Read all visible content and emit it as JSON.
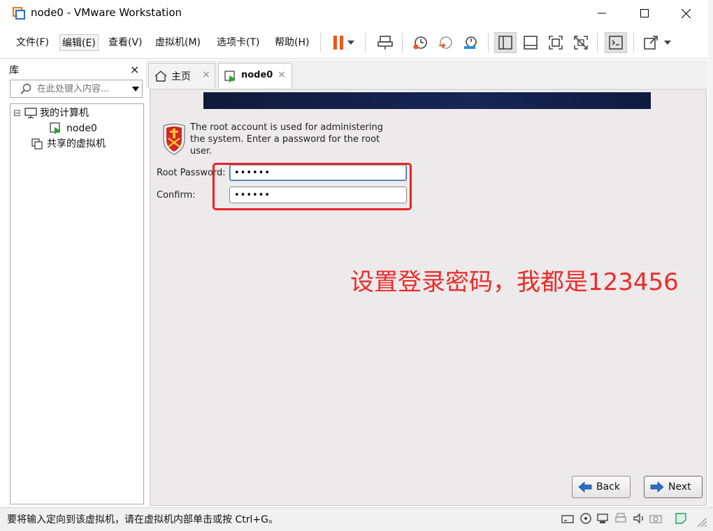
{
  "window": {
    "title": "node0 - VMware Workstation"
  },
  "menu": {
    "file": "文件(F)",
    "edit": "编辑(E)",
    "view": "查看(V)",
    "vm": "虚拟机(M)",
    "tabs": "选项卡(T)",
    "help": "帮助(H)"
  },
  "toolbar": {
    "icons": [
      "pause-icon",
      "dropdown-arrow-icon",
      "send-ctrl-alt-del-icon",
      "snapshot-icon",
      "revert-snapshot-icon",
      "manage-snapshots-icon",
      "show-library-icon",
      "thumbnail-bar-icon",
      "fullscreen-icon",
      "unity-icon",
      "console-view-icon",
      "stretch-icon",
      "dropdown-arrow-icon"
    ],
    "accent": "#e8591a"
  },
  "library": {
    "title": "库",
    "close": "×",
    "search_placeholder": "在此处键入内容...",
    "tree": {
      "root": "我的计算机",
      "collapse_glyph": "⊟",
      "vm": "node0",
      "shared": "共享的虚拟机"
    }
  },
  "tabs": [
    {
      "label": "主页",
      "close": "×"
    },
    {
      "label": "node0",
      "close": "×"
    }
  ],
  "installer": {
    "intro": "The root account is used for administering the system.  Enter a password for the root user.",
    "root_password_label": "Root Password:",
    "root_password_value": "••••••",
    "confirm_label": "Confirm:",
    "confirm_value": "••••••",
    "back_label": "Back",
    "next_label": "Next"
  },
  "annotation": {
    "text": "设置登录密码，我都是123456",
    "color": "#ec2b2b"
  },
  "status": {
    "text": "要将输入定向到该虚拟机，请在虚拟机内部单击或按 Ctrl+G。"
  }
}
